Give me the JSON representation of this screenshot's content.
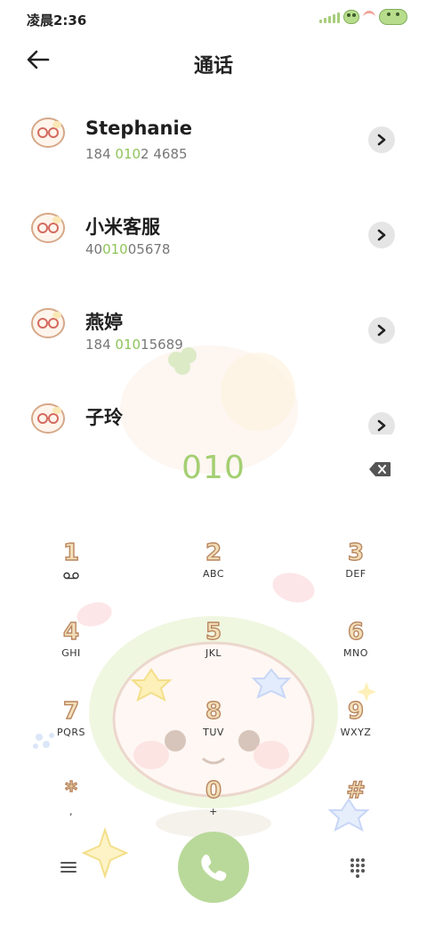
{
  "status_bar": {
    "time": "凌晨2:36"
  },
  "header": {
    "title": "通话"
  },
  "contacts": [
    {
      "name": "Stephanie",
      "number_pre": "184 ",
      "number_match": "010",
      "number_post": "2 4685"
    },
    {
      "name": "小米客服",
      "number_pre": "40",
      "number_match": "010",
      "number_post": "05678"
    },
    {
      "name": "燕婷",
      "number_pre": "184 ",
      "number_match": "010",
      "number_post": "15689"
    },
    {
      "name": "子玲",
      "number_pre": "",
      "number_match": "",
      "number_post": ""
    }
  ],
  "dialed_number": "010",
  "keypad": [
    {
      "digit": "1",
      "letters": ""
    },
    {
      "digit": "2",
      "letters": "ABC"
    },
    {
      "digit": "3",
      "letters": "DEF"
    },
    {
      "digit": "4",
      "letters": "GHI"
    },
    {
      "digit": "5",
      "letters": "JKL"
    },
    {
      "digit": "6",
      "letters": "MNO"
    },
    {
      "digit": "7",
      "letters": "PQRS"
    },
    {
      "digit": "8",
      "letters": "TUV"
    },
    {
      "digit": "9",
      "letters": "WXYZ"
    },
    {
      "digit": "*",
      "letters": ","
    },
    {
      "digit": "0",
      "letters": "+"
    },
    {
      "digit": "#",
      "letters": ""
    }
  ],
  "icons": {
    "back": "arrow-left-icon",
    "chevron": "chevron-right-icon",
    "backspace": "backspace-icon",
    "voicemail": "voicemail-icon",
    "menu": "menu-icon",
    "call": "phone-icon",
    "dialpad": "dialpad-icon"
  },
  "colors": {
    "accent_green": "#a4cf72",
    "call_button": "#b9d99a",
    "digit_fill": "#f2dfb9",
    "digit_outline": "#b9865f"
  }
}
